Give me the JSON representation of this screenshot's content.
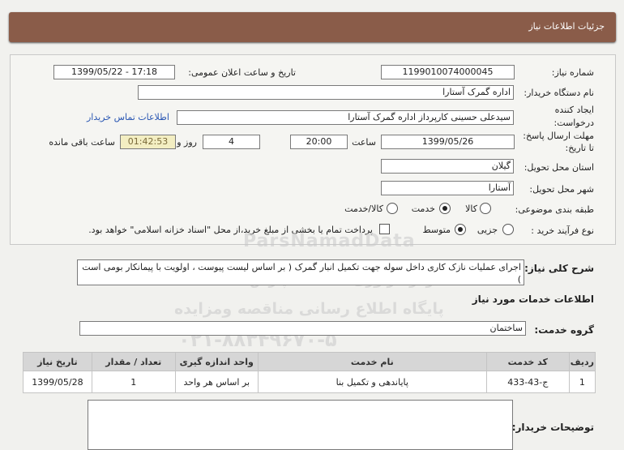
{
  "header": {
    "title": "جزئیات اطلاعات نیاز"
  },
  "form": {
    "need_number_label": "شماره نیاز:",
    "need_number": "1199010074000045",
    "announce_label": "تاریخ و ساعت اعلان عمومی:",
    "announce_value": "1399/05/22 - 17:18",
    "buyer_org_label": "نام دستگاه خریدار:",
    "buyer_org": "اداره گمرک آستارا",
    "creator_label_1": "ایجاد کننده",
    "creator_label_2": "درخواست:",
    "creator": "سیدعلی حسینی کارپرداز اداره گمرک آستارا",
    "contact_link": "اطلاعات تماس خریدار",
    "deadline_label_1": "مهلت ارسال پاسخ:",
    "deadline_label_2": "تا تاریخ:",
    "deadline_date": "1399/05/26",
    "time_label": "ساعت",
    "deadline_time": "20:00",
    "days": "4",
    "days_label": "روز و",
    "remaining": "01:42:53",
    "remaining_label": "ساعت باقی مانده",
    "province_label": "استان محل تحویل:",
    "province": "گیلان",
    "city_label": "شهر محل تحویل:",
    "city": "آستارا",
    "category_label": "طبقه بندی موضوعی:",
    "category_options": [
      "کالا",
      "خدمت",
      "کالا/خدمت"
    ],
    "category_selected": "خدمت",
    "process_label": "نوع فرآیند خرید :",
    "process_options": [
      "جزیی",
      "متوسط"
    ],
    "process_selected": "متوسط",
    "payment_note": "پرداخت تمام یا بخشی از مبلغ خرید،از محل \"اسناد خزانه اسلامی\" خواهد بود."
  },
  "summary": {
    "label": "شرح کلی نیاز:",
    "text": "اجرای عملیات نازک کاری داخل سوله جهت تکمیل انبار گمرک ( بر اساس لیست پیوست ، اولویت با پیمانکار بومی است )"
  },
  "services": {
    "section_title": "اطلاعات خدمات مورد نیاز",
    "group_label": "گروه خدمت:",
    "group_value": "ساختمان",
    "columns": [
      "ردیف",
      "کد خدمت",
      "نام خدمت",
      "واحد اندازه گیری",
      "تعداد / مقدار",
      "تاریخ نیاز"
    ],
    "rows": [
      {
        "index": "1",
        "code": "ج-43-433",
        "name": "پایاندهی و تکمیل بنا",
        "unit": "بر اساس هر واحد",
        "qty": "1",
        "date": "1399/05/28"
      }
    ]
  },
  "buyer_notes": {
    "label": "توضیحات خریدار:",
    "text": ""
  },
  "watermark": {
    "brand": "ParsNamadData",
    "line1": "مرکز فراوری اطلاعات پارس نماد داده",
    "line2": "پایگاه اطلاع رسانی مناقصه ومزایده",
    "phone": "۰۲۱-۸۸۳۴۹۶۷۰-۵"
  },
  "colors": {
    "header_bg": "#8a5c49",
    "link": "#2a57b3",
    "remaining_bg": "#f3eec2"
  }
}
